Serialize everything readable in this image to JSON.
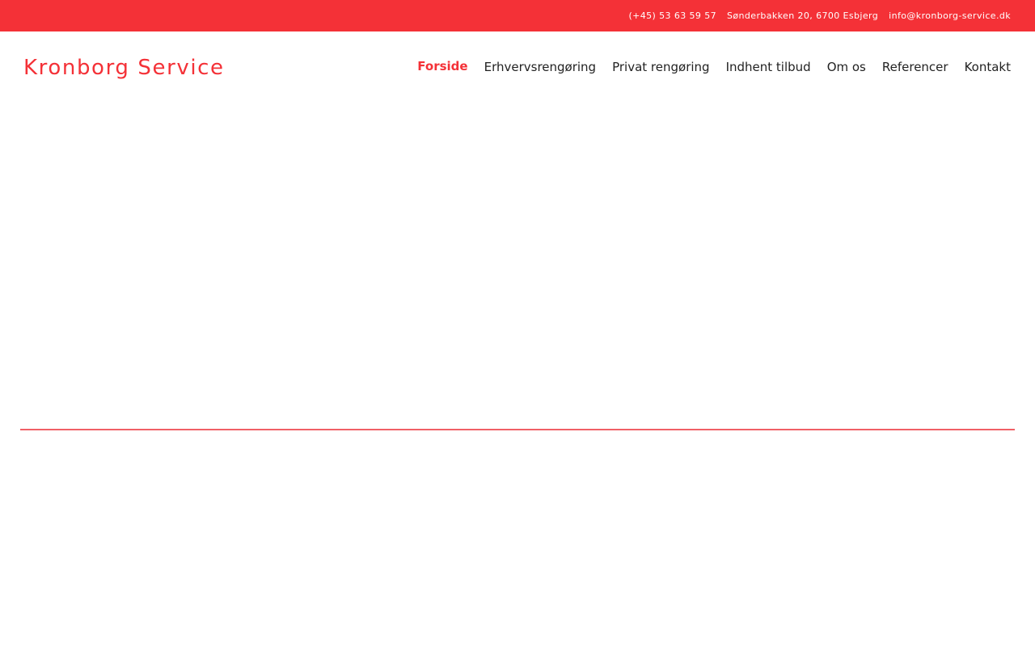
{
  "topbar": {
    "background": "#f43137",
    "phone": "(+45) 53 63 59 57",
    "address": "Sønderbakken 20, 6700 Esbjerg",
    "email": "info@kronborg-service.dk"
  },
  "header": {
    "logo_text": "Kronborg Service",
    "brand_color": "#f43137"
  },
  "nav": {
    "items": [
      {
        "label": "Forside",
        "active": true
      },
      {
        "label": "Erhvervsrengøring",
        "active": false
      },
      {
        "label": "Privat rengøring",
        "active": false
      },
      {
        "label": "Indhent tilbud",
        "active": false
      },
      {
        "label": "Om os",
        "active": false
      },
      {
        "label": "Referencer",
        "active": false
      },
      {
        "label": "Kontakt",
        "active": false
      }
    ]
  },
  "divider_color": "#f06066"
}
